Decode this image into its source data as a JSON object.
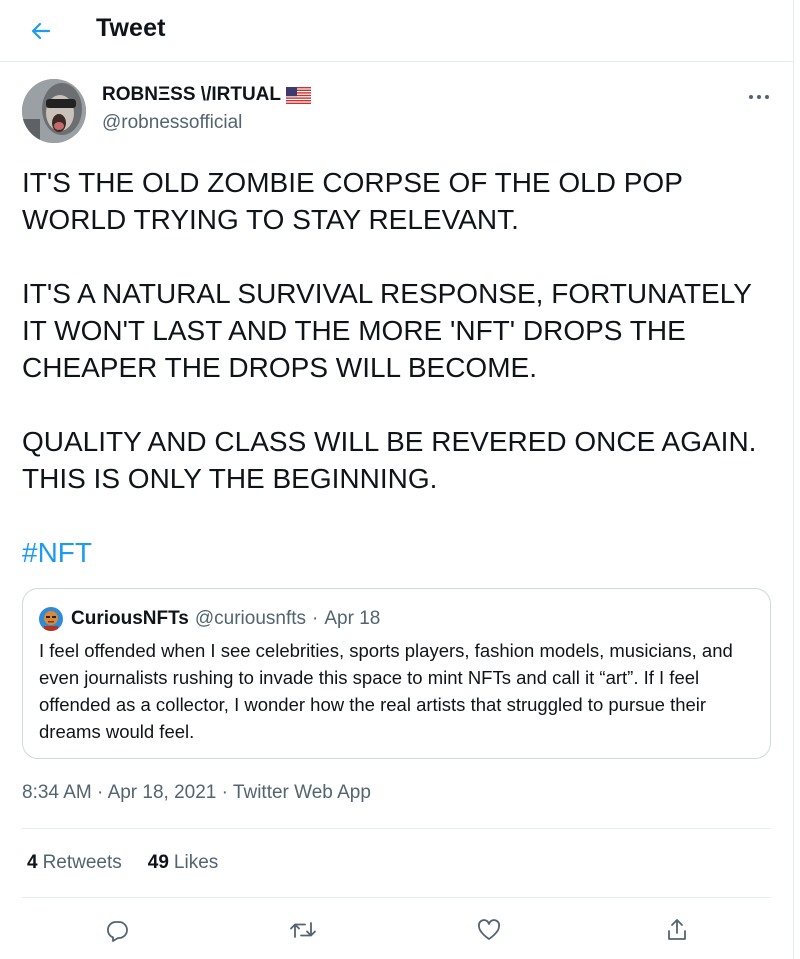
{
  "header": {
    "title": "Tweet",
    "back_icon": "arrow-left-icon"
  },
  "author": {
    "display_name": "ROBNΞSS \\/IRTUAL",
    "handle": "@robnessofficial",
    "flag_icon": "us-flag-icon"
  },
  "tweet": {
    "paragraphs": [
      "IT'S THE OLD ZOMBIE CORPSE OF THE OLD POP\nWORLD TRYING TO STAY RELEVANT.",
      "IT'S A NATURAL SURVIVAL RESPONSE, FORTUNATELY\nIT WON'T LAST AND THE MORE 'NFT' DROPS THE\nCHEAPER THE DROPS WILL BECOME.",
      "QUALITY AND CLASS WILL BE REVERED ONCE AGAIN.\nTHIS IS ONLY THE BEGINNING."
    ],
    "hashtag": "#NFT"
  },
  "quote": {
    "name": "CuriousNFTs",
    "handle": "@curiousnfts",
    "separator": "·",
    "date": "Apr 18",
    "text": "I feel offended when I see celebrities, sports players, fashion models, musicians, and even journalists rushing to invade this space to mint NFTs and call it “art”. If I feel offended as a collector, I wonder how the real artists that struggled to pursue their dreams would feel."
  },
  "meta": {
    "time": "8:34 AM",
    "sep1": " · ",
    "date": "Apr 18, 2021",
    "sep2": " · ",
    "source": "Twitter Web App"
  },
  "stats": {
    "retweets_count": "4",
    "retweets_label": "Retweets",
    "likes_count": "49",
    "likes_label": "Likes"
  },
  "actions": [
    "reply-icon",
    "retweet-icon",
    "like-icon",
    "share-icon"
  ],
  "colors": {
    "accent": "#1d9bf0",
    "text": "#0f1419",
    "muted": "#536471",
    "border": "#e6ecf0"
  }
}
